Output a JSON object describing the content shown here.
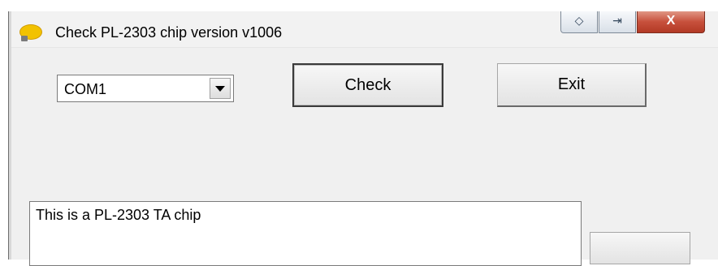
{
  "window": {
    "title": "Check PL-2303 chip version v1006",
    "icon": "app-bubble-icon",
    "caption_buttons": [
      {
        "name": "window-move-icon",
        "glyph": "◇"
      },
      {
        "name": "window-restore-icon",
        "glyph": "⇥"
      },
      {
        "name": "close-icon",
        "glyph": "X"
      }
    ]
  },
  "controls": {
    "port_select": {
      "selected": "COM1"
    },
    "check_label": "Check",
    "exit_label": "Exit"
  },
  "output": {
    "text": "This is a PL-2303 TA chip"
  },
  "colors": {
    "window_bg": "#f0f0f0",
    "close_button": "#c7503c",
    "combo_border": "#7a7a7a"
  }
}
